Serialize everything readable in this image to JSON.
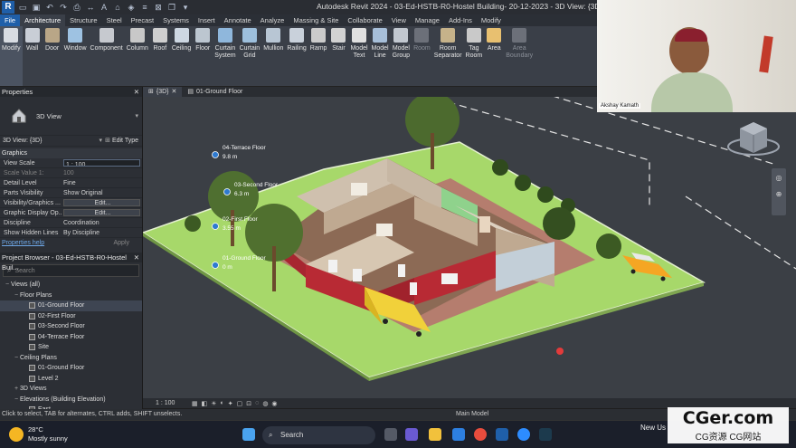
{
  "app": {
    "title": "Autodesk Revit 2024 - 03-Ed-HSTB-R0-Hostel Building- 20-12-2023 - 3D View: {3D}",
    "logo_letter": "R"
  },
  "tabs": [
    "File",
    "Architecture",
    "Structure",
    "Steel",
    "Precast",
    "Systems",
    "Insert",
    "Annotate",
    "Analyze",
    "Massing & Site",
    "Collaborate",
    "View",
    "Manage",
    "Add-Ins",
    "Modify"
  ],
  "active_tab": "Architecture",
  "ribbon": [
    {
      "id": "modify",
      "label": "Modify",
      "color": "#d8dce2",
      "selected": true
    },
    {
      "id": "wall",
      "label": "Wall",
      "color": "#c9ced6"
    },
    {
      "id": "door",
      "label": "Door",
      "color": "#b9a687"
    },
    {
      "id": "window",
      "label": "Window",
      "color": "#9ec2e2"
    },
    {
      "id": "component",
      "label": "Component",
      "color": "#c6c9cf"
    },
    {
      "id": "column",
      "label": "Column",
      "color": "#c8c8c8"
    },
    {
      "id": "roof",
      "label": "Roof",
      "color": "#cfcfcf"
    },
    {
      "id": "ceiling",
      "label": "Ceiling",
      "color": "#cdd7e2"
    },
    {
      "id": "floor",
      "label": "Floor",
      "color": "#bcc6d0"
    },
    {
      "id": "curtain-system",
      "label": "Curtain\nSystem",
      "color": "#8fb7dc"
    },
    {
      "id": "curtain-grid",
      "label": "Curtain\nGrid",
      "color": "#9dbfdc"
    },
    {
      "id": "mullion",
      "label": "Mullion",
      "color": "#b8c6d4"
    },
    {
      "id": "railing",
      "label": "Railing",
      "color": "#c9d1db"
    },
    {
      "id": "ramp",
      "label": "Ramp",
      "color": "#cbcbcb"
    },
    {
      "id": "stair",
      "label": "Stair",
      "color": "#d2d2d2"
    },
    {
      "id": "model-text",
      "label": "Model\nText",
      "color": "#e0e0e0"
    },
    {
      "id": "model-line",
      "label": "Model\nLine",
      "color": "#a7bfd9"
    },
    {
      "id": "model-group",
      "label": "Model\nGroup",
      "color": "#c2c8d0"
    },
    {
      "id": "room",
      "label": "Room",
      "color": "#6c7079",
      "dim": true
    },
    {
      "id": "room-separator",
      "label": "Room\nSeparator",
      "color": "#c6b28a"
    },
    {
      "id": "tag-room",
      "label": "Tag\nRoom",
      "color": "#c9c9c9"
    },
    {
      "id": "area",
      "label": "Area",
      "color": "#e8c070"
    },
    {
      "id": "area-boundary",
      "label": "Area\nBoundary",
      "color": "#6c7079",
      "dim": true
    }
  ],
  "properties": {
    "header": "Properties",
    "type_name": "3D View",
    "selector": "3D View: {3D}",
    "edit_type": "Edit Type",
    "section": "Graphics",
    "rows": [
      {
        "k": "View Scale",
        "v": "1 : 100",
        "kind": "input"
      },
      {
        "k": "Scale Value    1:",
        "v": "100",
        "dim": true
      },
      {
        "k": "Detail Level",
        "v": "Fine"
      },
      {
        "k": "Parts Visibility",
        "v": "Show Original"
      },
      {
        "k": "Visibility/Graphics ...",
        "v": "Edit...",
        "kind": "btn"
      },
      {
        "k": "Graphic Display Op...",
        "v": "Edit...",
        "kind": "btn"
      },
      {
        "k": "Discipline",
        "v": "Coordination"
      },
      {
        "k": "Show Hidden Lines",
        "v": "By Discipline"
      }
    ],
    "help": "Properties help",
    "apply": "Apply"
  },
  "browser": {
    "header": "Project Browser - 03-Ed-HSTB-R0-Hostel Buil...",
    "search_placeholder": "Search",
    "items": [
      {
        "label": "Views (all)",
        "level": 0,
        "tw": "−"
      },
      {
        "label": "Floor Plans",
        "level": 1,
        "tw": "−"
      },
      {
        "label": "01-Ground Floor",
        "level": 2,
        "icon": true,
        "sel": true
      },
      {
        "label": "02-First Floor",
        "level": 2,
        "icon": true
      },
      {
        "label": "03-Second Floor",
        "level": 2,
        "icon": true
      },
      {
        "label": "04-Terrace Floor",
        "level": 2,
        "icon": true
      },
      {
        "label": "Site",
        "level": 2,
        "icon": true
      },
      {
        "label": "Ceiling Plans",
        "level": 1,
        "tw": "−"
      },
      {
        "label": "01-Ground Floor",
        "level": 2,
        "icon": true
      },
      {
        "label": "Level 2",
        "level": 2,
        "icon": true
      },
      {
        "label": "3D Views",
        "level": 1,
        "tw": "+"
      },
      {
        "label": "Elevations (Building Elevation)",
        "level": 1,
        "tw": "−"
      },
      {
        "label": "East",
        "level": 2,
        "icon": true
      }
    ]
  },
  "view_tabs": [
    {
      "label": "{3D}",
      "active": true
    },
    {
      "label": "01-Ground Floor"
    }
  ],
  "levels": [
    {
      "name": "04-Terrace Floor",
      "elev": "9.8 m"
    },
    {
      "name": "03-Second Floor",
      "elev": "6.3 m"
    },
    {
      "name": "02-First Floor",
      "elev": "3.55 m"
    },
    {
      "name": "01-Ground Floor",
      "elev": "0 m"
    }
  ],
  "view_scale": "1 : 100",
  "status": {
    "hint": "Click to select, TAB for alternates, CTRL adds, SHIFT unselects.",
    "model": "Main Model"
  },
  "taskbar": {
    "temp": "28°C",
    "weather": "Mostly sunny",
    "search": "Search",
    "new": "New Us"
  },
  "watermark": {
    "line1": "CGer.com",
    "line2": "CG资源 CG网站"
  },
  "webcam": {
    "name": "Akshay Kamath"
  }
}
